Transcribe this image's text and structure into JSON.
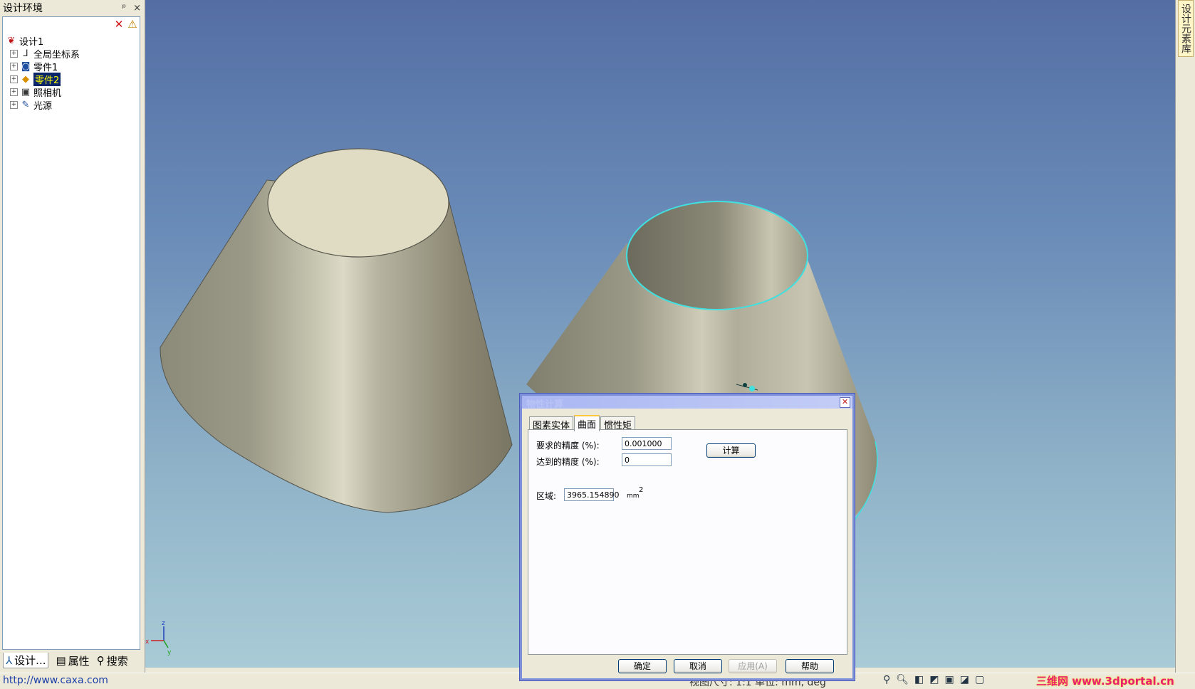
{
  "left_panel": {
    "title": "设计环境",
    "pin_glyph": "ᵖ",
    "close_glyph": "×",
    "toolbar": {
      "delete_icon": "delete-icon",
      "filter_icon": "filter-icon"
    },
    "tree": [
      {
        "label": "设计1",
        "icon": "design-root-icon",
        "expander": false,
        "selected": false
      },
      {
        "label": "全局坐标系",
        "icon": "coordinate-system-icon",
        "expander": true,
        "selected": false
      },
      {
        "label": "零件1",
        "icon": "part-icon",
        "expander": true,
        "selected": false
      },
      {
        "label": "零件2",
        "icon": "surface-part-icon",
        "expander": true,
        "selected": true
      },
      {
        "label": "照相机",
        "icon": "camera-icon",
        "expander": true,
        "selected": false
      },
      {
        "label": "光源",
        "icon": "light-source-icon",
        "expander": true,
        "selected": false
      }
    ],
    "bottom_tabs": [
      {
        "label": "设计...",
        "icon": "design-tab-icon"
      },
      {
        "label": "属性",
        "icon": "properties-icon"
      },
      {
        "label": "搜索",
        "icon": "search-icon"
      }
    ]
  },
  "right_strip": {
    "tab_label": "设计元素库"
  },
  "viewport": {
    "axis": {
      "x": "x",
      "y": "y",
      "z": "z"
    },
    "colors": {
      "highlight": "#40e0e0",
      "surface": "#a8a490",
      "cap": "#e0dcc4"
    }
  },
  "dialog": {
    "title": "物性计算",
    "tabs": [
      "图素实体",
      "曲面",
      "惯性矩"
    ],
    "active_tab": 1,
    "required_precision_label": "要求的精度  (%):",
    "required_precision_value": "0.001000",
    "achieved_precision_label": "达到的精度  (%):",
    "achieved_precision_value": "0",
    "compute_button": "计算",
    "area_label": "区域:",
    "area_value": "3965.154890",
    "area_unit": "mm",
    "area_unit_exponent": "2",
    "buttons": {
      "ok": "确定",
      "cancel": "取消",
      "apply": "应用(A)",
      "help": "帮助"
    }
  },
  "status_bar": {
    "url": "http://www.caxa.com",
    "info": "视图尺寸: 1:1   单位: mm, deg",
    "watermark": "三维网 www.3dportal.cn"
  }
}
